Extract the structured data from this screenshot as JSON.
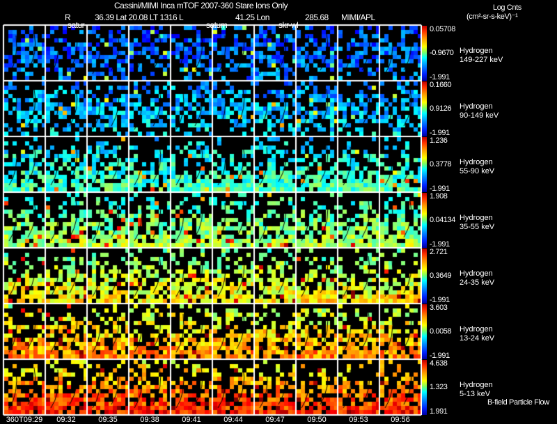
{
  "header": {
    "title": "Cassini/MIMI Inca mTOF  2007-360   Stare   Ions Only",
    "r_label": "R",
    "position": "36.39 Lat 20.08 LT 1316 L",
    "lon": "41.25 Lon",
    "lon_value": "285.68",
    "credit": "MIMI/APL",
    "overlay_labels": [
      "satur",
      "saturn",
      "skr-wl"
    ]
  },
  "colorbar_title": {
    "line1": "Log Cnts",
    "line2": "(cm²-sr-s-keV)⁻¹"
  },
  "footer_note": "B-field Particle Flow",
  "chart_data": {
    "type": "heatmap",
    "title": "Cassini/MIMI Inca mTOF  2007-360   Stare   Ions Only",
    "time_ticks": [
      "360T09:29",
      "09:32",
      "09:35",
      "09:38",
      "09:41",
      "09:44",
      "09:47",
      "09:50",
      "09:53",
      "09:56"
    ],
    "colormap": "jet (blue low, red high)",
    "rows": [
      {
        "species": "Hydrogen",
        "energy": "149-227 keV",
        "max": "0.05708",
        "mid": "-0.9670",
        "min": "-1.991"
      },
      {
        "species": "Hydrogen",
        "energy": "90-149 keV",
        "max": "0.1660",
        "mid": "0.9126",
        "min": "-1.991"
      },
      {
        "species": "Hydrogen",
        "energy": "55-90 keV",
        "max": "1.236",
        "mid": "0.3778",
        "min": "-1.991"
      },
      {
        "species": "Hydrogen",
        "energy": "35-55 keV",
        "max": "1.908",
        "mid": "0.04134",
        "min": "-1.991"
      },
      {
        "species": "Hydrogen",
        "energy": "24-35 keV",
        "max": "2.721",
        "mid": "0.3649",
        "min": "-1.991"
      },
      {
        "species": "Hydrogen",
        "energy": "13-24 keV",
        "max": "3.603",
        "mid": "0.0058",
        "min": "-1.991"
      },
      {
        "species": "Hydrogen",
        "energy": "5-13 keV",
        "max": "4.638",
        "mid": "1.323",
        "min": "1.991"
      }
    ]
  }
}
